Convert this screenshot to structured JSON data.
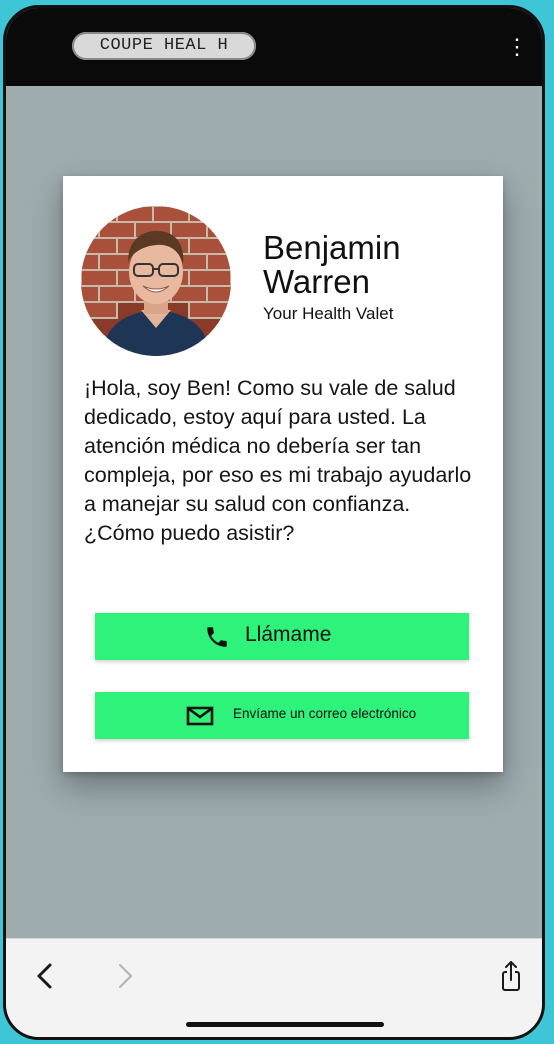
{
  "header": {
    "logo_text": "COUPE HEAL H",
    "menu_icon": "kebab-menu-icon"
  },
  "profile": {
    "name": "Benjamin Warren",
    "subtitle": "Your Health Valet",
    "avatar_alt": "Benjamin Warren portrait"
  },
  "bio": "¡Hola, soy Ben! Como su vale de salud dedicado, estoy aquí para usted. La atención médica no debería ser tan compleja, por eso es mi trabajo ayudarlo a manejar su salud con confianza. ¿Cómo puedo asistir?",
  "buttons": {
    "call_label": "Llámame",
    "call_icon": "phone-icon",
    "email_label": "Envíame un correo electrónico",
    "email_icon": "mail-icon"
  },
  "browser_bar": {
    "back_icon": "chevron-left-icon",
    "forward_icon": "chevron-right-icon",
    "share_icon": "share-icon"
  },
  "colors": {
    "page_background": "#3ec6d6",
    "screen_background": "#9eacaf",
    "button_green": "#2ff27a",
    "top_bar": "#0a0a0a"
  }
}
